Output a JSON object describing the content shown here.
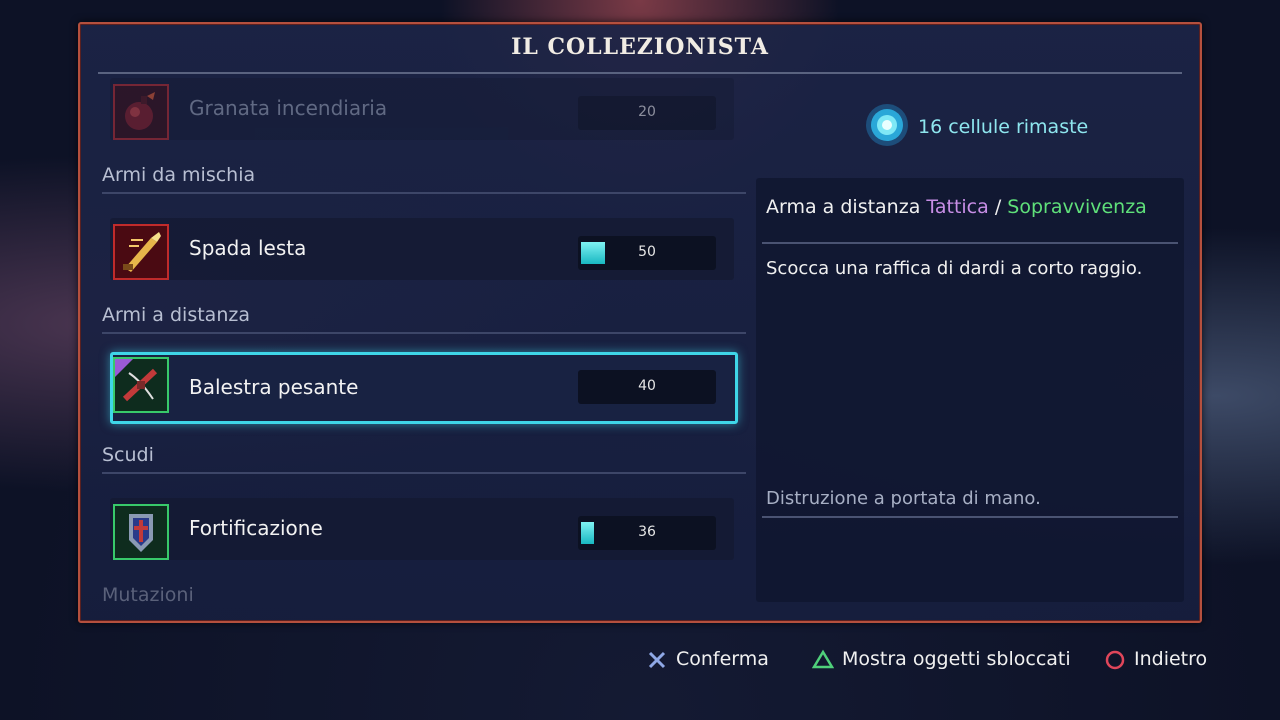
{
  "title": "IL COLLEZIONISTA",
  "list": {
    "top_item": {
      "label": "Granata incendiaria",
      "cost": "20",
      "progress": 0
    },
    "sections": [
      {
        "label": "Armi da mischia",
        "item": {
          "label": "Spada lesta",
          "cost": "50",
          "progress": 0.18
        }
      },
      {
        "label": "Armi a distanza",
        "item": {
          "label": "Balestra pesante",
          "cost": "40",
          "progress": 0
        }
      },
      {
        "label": "Scudi",
        "item": {
          "label": "Fortificazione",
          "cost": "36",
          "progress": 0.1
        }
      },
      {
        "label": "Mutazioni"
      }
    ]
  },
  "cells": {
    "text": "16 cellule rimaste",
    "icon": "cell-icon"
  },
  "details": {
    "type_prefix": "Arma a distanza",
    "tag1": "Tattica",
    "separator": "/",
    "tag2": "Sopravvivenza",
    "description": "Scocca una raffica di dardi a corto raggio.",
    "flavor": "Distruzione a portata di mano."
  },
  "footer": {
    "confirm": {
      "label": "Conferma",
      "icon": "cross-button-icon"
    },
    "show_unlocked": {
      "label": "Mostra oggetti sbloccati",
      "icon": "triangle-button-icon"
    },
    "back": {
      "label": "Indietro",
      "icon": "circle-button-icon"
    }
  },
  "colors": {
    "accent": "#3fd6e8",
    "border": "#b5503e",
    "tactic": "#c88ee6",
    "survival": "#5fe07a"
  }
}
